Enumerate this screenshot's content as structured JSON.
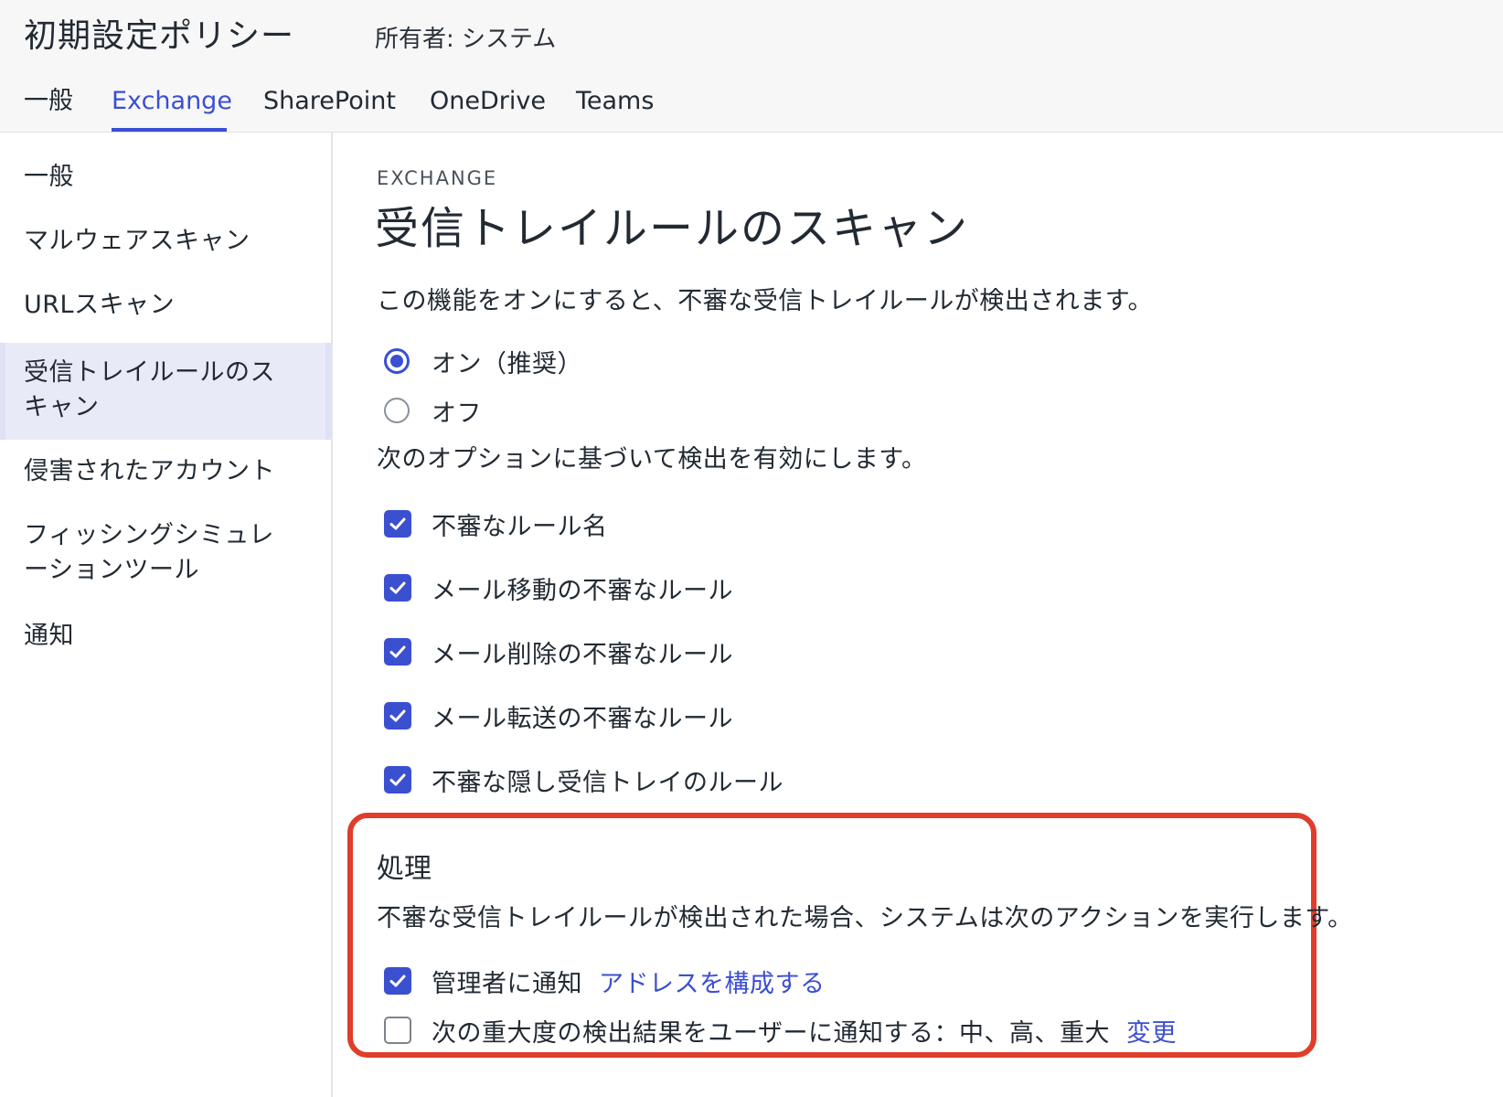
{
  "header": {
    "title": "初期設定ポリシー",
    "owner": "所有者: システム",
    "tabs": [
      {
        "label": "一般"
      },
      {
        "label": "Exchange"
      },
      {
        "label": "SharePoint"
      },
      {
        "label": "OneDrive"
      },
      {
        "label": "Teams"
      }
    ],
    "active_tab": "Exchange"
  },
  "sidebar": {
    "items": [
      {
        "label": "一般"
      },
      {
        "label": "マルウェアスキャン"
      },
      {
        "label": "URLスキャン"
      },
      {
        "label": "受信トレイルールのスキャン"
      },
      {
        "label": "侵害されたアカウント"
      },
      {
        "label": "フィッシングシミュレーションツール"
      },
      {
        "label": "通知"
      }
    ],
    "active_item": "受信トレイルールのスキャン"
  },
  "main": {
    "section_label": "EXCHANGE",
    "title": "受信トレイルールのスキャン",
    "description": "この機能をオンにすると、不審な受信トレイルールが検出されます。",
    "radio_options": [
      {
        "label": "オン（推奨）",
        "checked": true
      },
      {
        "label": "オフ",
        "checked": false
      }
    ],
    "options_intro": "次のオプションに基づいて検出を有効にします。",
    "detection_options": [
      {
        "label": "不審なルール名",
        "checked": true
      },
      {
        "label": "メール移動の不審なルール",
        "checked": true
      },
      {
        "label": "メール削除の不審なルール",
        "checked": true
      },
      {
        "label": "メール転送の不審なルール",
        "checked": true
      },
      {
        "label": "不審な隠し受信トレイのルール",
        "checked": true
      }
    ],
    "action_section": {
      "heading": "処理",
      "description": "不審な受信トレイルールが検出された場合、システムは次のアクションを実行します。",
      "notify_admin": {
        "label": "管理者に通知",
        "checked": true,
        "link": "アドレスを構成する"
      },
      "notify_user": {
        "label": "次の重大度の検出結果をユーザーに通知する：中、高、重大",
        "checked": false,
        "link": "変更"
      }
    }
  },
  "colors": {
    "accent": "#3b4fd1",
    "highlight_border": "#e03d2b",
    "header_bg": "#f7f7f8",
    "active_sidebar_bg": "#e9eaf8"
  }
}
